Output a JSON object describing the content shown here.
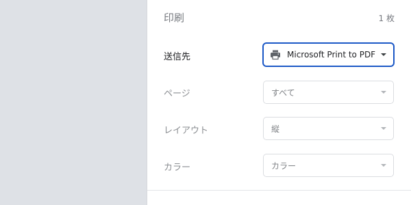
{
  "print": {
    "title": "印刷",
    "sheet_count": "1 枚"
  },
  "destination": {
    "label": "送信先",
    "value": "Microsoft Print to PDF",
    "icon": "printer-icon"
  },
  "pages": {
    "label": "ページ",
    "value": "すべて"
  },
  "layout": {
    "label": "レイアウト",
    "value": "縦"
  },
  "color": {
    "label": "カラー",
    "value": "カラー"
  },
  "colors": {
    "focus_border": "#1a57c6",
    "preview_background": "#dee1e6"
  }
}
